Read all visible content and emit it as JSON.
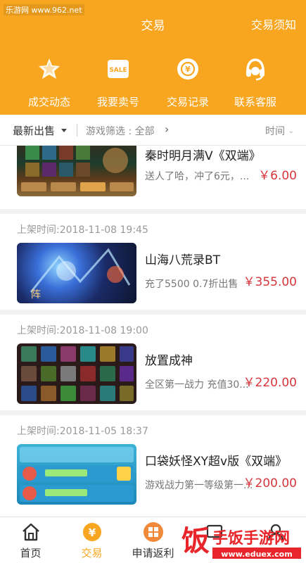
{
  "watermark": "乐游网 www.962.net",
  "header": {
    "title": "交易",
    "notice": "交易须知"
  },
  "quick": [
    {
      "label": "成交动态",
      "icon": "star-icon"
    },
    {
      "label": "我要卖号",
      "icon": "sale-tag-icon",
      "badge": "SALE"
    },
    {
      "label": "交易记录",
      "icon": "coin-record-icon"
    },
    {
      "label": "联系客服",
      "icon": "headset-icon"
    }
  ],
  "filter": {
    "sort": "最新出售",
    "game_filter": "游戏筛选 : 全部",
    "time": "时间"
  },
  "listings": [
    {
      "time": "",
      "name": "秦时明月满V《双端》",
      "desc": "送人了哈，冲了6元，...",
      "price": "￥6.00"
    },
    {
      "time": "上架时间:2018-11-08 19:45",
      "name": "山海八荒录BT",
      "desc": "充了5500  0.7折出售",
      "price": "￥355.00"
    },
    {
      "time": "上架时间:2018-11-08 19:00",
      "name": "放置成神",
      "desc": "全区第一战力  充值30...",
      "price": "￥220.00"
    },
    {
      "time": "上架时间:2018-11-05 18:37",
      "name": "口袋妖怪XY超v版《双端》",
      "desc": "游戏战力第一等级第一...",
      "price": "￥200.00"
    }
  ],
  "tabs": [
    {
      "label": "首页",
      "icon": "home-icon"
    },
    {
      "label": "交易",
      "icon": "yen-icon"
    },
    {
      "label": "申请返利",
      "icon": "rebate-icon"
    },
    {
      "label": "",
      "icon": "message-icon"
    },
    {
      "label": "",
      "icon": "user-icon"
    }
  ],
  "brand_watermark": {
    "main": "手饭手游网",
    "url": "www.eduex.com"
  },
  "colors": {
    "accent": "#f8a61f",
    "price": "#d8353a"
  }
}
